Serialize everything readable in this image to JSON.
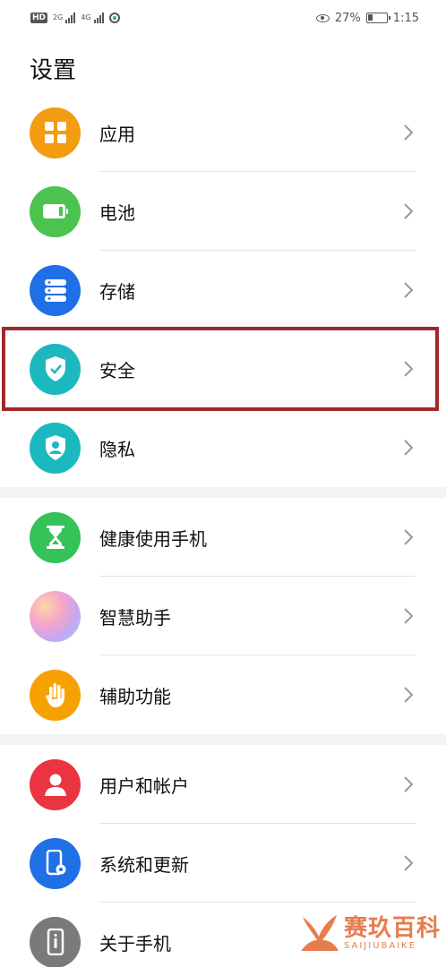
{
  "status_bar": {
    "hd_label": "HD",
    "sim1_tag": "2G",
    "sim2_tag": "4G",
    "battery_percent": "27%",
    "time": "1:15",
    "icons": [
      "hd-icon",
      "signal-icon",
      "signal-icon",
      "nfc-icon",
      "eye-icon",
      "battery-icon"
    ]
  },
  "page": {
    "title": "设置"
  },
  "groups": [
    {
      "items": [
        {
          "label": "应用",
          "icon": "apps-icon",
          "color": "#f39c12"
        },
        {
          "label": "电池",
          "icon": "battery-icon",
          "color": "#4cc24f"
        },
        {
          "label": "存储",
          "icon": "storage-icon",
          "color": "#1f6fe6"
        },
        {
          "label": "安全",
          "icon": "shield-check-icon",
          "color": "#1cb8bf",
          "highlighted": true
        },
        {
          "label": "隐私",
          "icon": "privacy-icon",
          "color": "#1cb8bf"
        }
      ]
    },
    {
      "items": [
        {
          "label": "健康使用手机",
          "icon": "hourglass-icon",
          "color": "#35c258"
        },
        {
          "label": "智慧助手",
          "icon": "assistant-icon",
          "color": "#c7a7f0"
        },
        {
          "label": "辅助功能",
          "icon": "hand-icon",
          "color": "#f5a100"
        }
      ]
    },
    {
      "items": [
        {
          "label": "用户和帐户",
          "icon": "user-icon",
          "color": "#ea3441"
        },
        {
          "label": "系统和更新",
          "icon": "phone-gear-icon",
          "color": "#1f6fe6"
        },
        {
          "label": "关于手机",
          "icon": "phone-info-icon",
          "color": "#7a7a7a"
        }
      ]
    }
  ],
  "watermark": {
    "main": "赛玖百科",
    "sub": "SAIJIUBAIKE"
  }
}
